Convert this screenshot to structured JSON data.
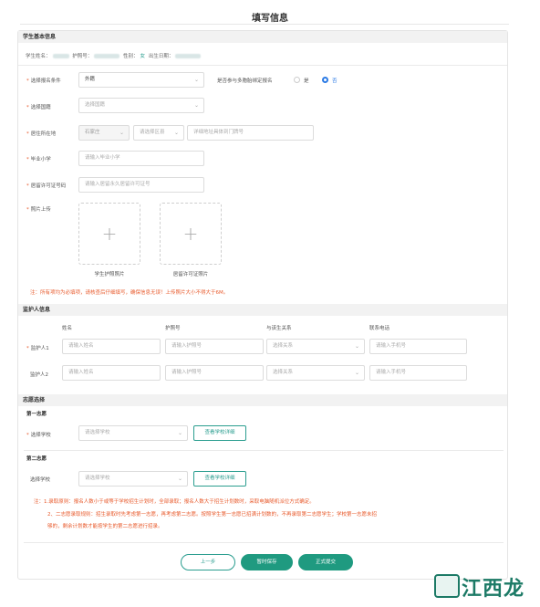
{
  "page": {
    "title": "填写信息"
  },
  "basic_section": {
    "header": "学生基本信息",
    "name_label": "学生姓名：",
    "passport_label": "护照号：",
    "gender_label": "性别：",
    "gender_value": "女",
    "birthdate_label": "出生日期："
  },
  "form": {
    "condition": {
      "label": "选择报名条件",
      "value": "外籍"
    },
    "participate": {
      "question": "是否参与多胞胎绑定报名",
      "yes": "是",
      "no": "否",
      "selected": "否"
    },
    "nationality": {
      "label": "选择国籍",
      "placeholder": "选择国籍"
    },
    "residence": {
      "label": "居住所在地",
      "city": "石家庄",
      "district_placeholder": "请选择区县",
      "address_placeholder": "详细地址具体到门牌号"
    },
    "primary_school": {
      "label": "毕业小学",
      "placeholder": "请输入毕业小学"
    },
    "permit_no": {
      "label": "居留许可证号码",
      "placeholder": "请输入居留永久居留许可证号"
    },
    "photo": {
      "label": "照片上传",
      "caption_passport": "学生护照照片",
      "caption_permit": "居留许可证照片"
    },
    "warning": "注：所有项均为必填项，请核查后仔细填写，确保信息无误！上传照片大小不得大于6M。"
  },
  "guardian_section": {
    "header": "监护人信息",
    "columns": [
      "姓名",
      "护照号",
      "与该生关系",
      "联系电话"
    ],
    "rows": [
      {
        "label": "监护人1",
        "required": true,
        "name_ph": "请输入姓名",
        "passport_ph": "请输入护照号",
        "relation_ph": "选择关系",
        "phone_ph": "请输入手机号"
      },
      {
        "label": "监护人2",
        "required": false,
        "name_ph": "请输入姓名",
        "passport_ph": "请输入护照号",
        "relation_ph": "选择关系",
        "phone_ph": "请输入手机号"
      }
    ]
  },
  "choice_section": {
    "header": "志愿选择",
    "first": {
      "title": "第一志愿",
      "label": "选择学校",
      "placeholder": "请选择学校",
      "button": "查看学校详细"
    },
    "second": {
      "title": "第二志愿",
      "label": "选择学校",
      "placeholder": "请选择学校",
      "button": "查看学校详细"
    },
    "notes": [
      "注：1.录取原则：报名人数小于或等于学校招生计划时，全部录取；报名人数大于招生计划数时，采取电脑随机派位方式确定。",
      "2、二志愿录取规则：招生录取时先考虑第一志愿，再考虑第二志愿。按照学生第一志愿已招满计划数的，不再录取第二志愿学生；学校第一志愿未招",
      "够的，剩余计划数才能按学生的第二志愿进行招录。"
    ]
  },
  "actions": {
    "prev": "上一步",
    "save": "暂时保存",
    "submit": "正式提交"
  },
  "watermark": {
    "text": "江西龙网"
  }
}
